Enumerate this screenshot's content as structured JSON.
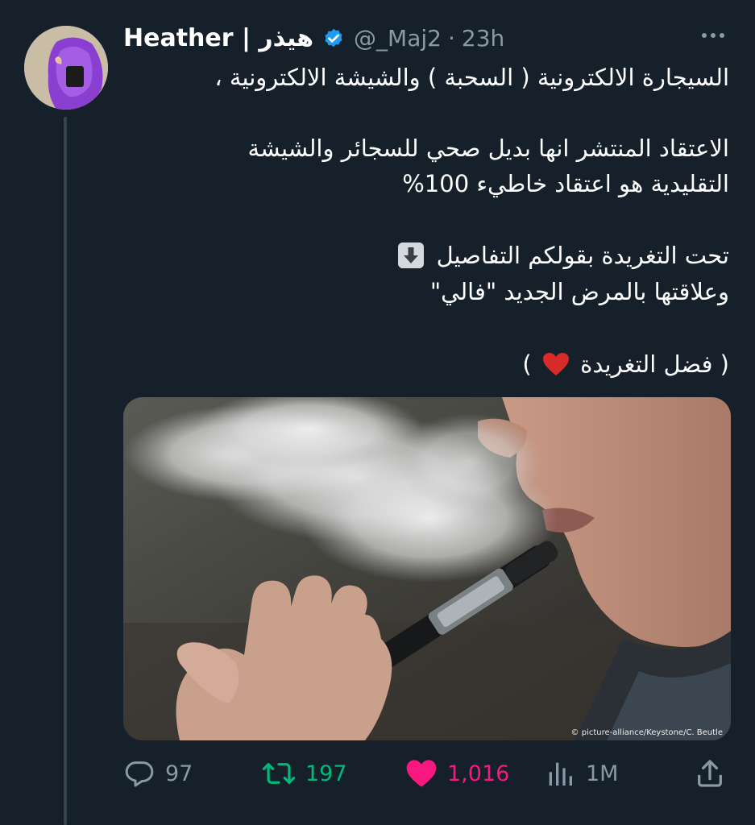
{
  "author": {
    "display_name": "Heather | هيذر",
    "handle": "@_Maj2",
    "dot": "·",
    "time": "23h"
  },
  "tweet": {
    "line1": "السيجارة الالكترونية ( السحبة ) والشيشة الالكترونية ،",
    "line2": "الاعتقاد المنتشر انها بديل صحي للسجائر والشيشة",
    "line3": "التقليدية هو اعتقاد خاطيء 100%",
    "line4": "تحت التغريدة بقولكم التفاصيل",
    "line5": "وعلاقتها بالمرض الجديد \"فالي\"",
    "line6_start": "( فضل التغريدة",
    "line6_end": ")"
  },
  "media": {
    "credit": "© picture-alliance/Keystone/C. Beutle"
  },
  "actions": {
    "replies": "97",
    "retweets": "197",
    "likes": "1,016",
    "views": "1M"
  },
  "colors": {
    "background": "#15202b",
    "muted": "#8b98a5",
    "verified": "#1d9bf0",
    "retweet": "#00ba7c",
    "like": "#f91880"
  },
  "icons": [
    "verified-icon",
    "more-icon",
    "down-arrow-emoji",
    "red-heart-emoji",
    "reply-icon",
    "retweet-icon",
    "like-icon",
    "views-icon",
    "share-icon"
  ]
}
